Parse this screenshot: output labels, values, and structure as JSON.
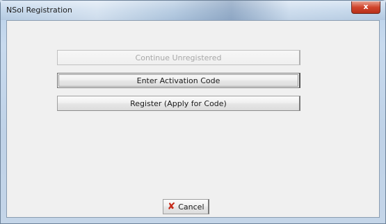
{
  "window": {
    "title": "NSol Registration",
    "close_label": "x"
  },
  "buttons": {
    "continue_label": "Continue Unregistered",
    "activate_label": "Enter Activation Code",
    "register_label": "Register (Apply for Code)",
    "cancel_label": "Cancel"
  },
  "icons": {
    "close": "close-icon",
    "cancel": "red-x-icon"
  },
  "colors": {
    "cancel_x": "#c62b1a",
    "close_button": "#d0452c"
  }
}
